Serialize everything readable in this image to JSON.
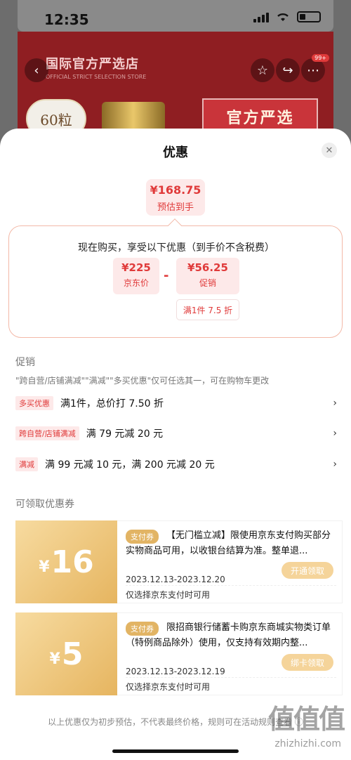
{
  "status_bar": {
    "time": "12:35"
  },
  "product_banner": {
    "store_title": "国际官方严选店",
    "store_subtitle": "OFFICIAL STRICT SELECTION STORE",
    "pill_text": "60粒",
    "stamp_text": "官方严选",
    "cart_badge": "99+"
  },
  "sheet": {
    "title": "优惠",
    "estimated_price": {
      "amount": "¥168.75",
      "label": "预估到手"
    },
    "calculation": {
      "title": "现在购买，享受以下优惠（到手价不含税费）",
      "base": {
        "amount": "¥225",
        "label": "京东价"
      },
      "operator": "-",
      "discount": {
        "amount": "¥56.25",
        "label": "促销"
      },
      "discount_tag": "满1件 7.5 折"
    },
    "promotions": {
      "heading": "促销",
      "note": "\"跨自营/店铺满减\"\"满减\"\"多买优惠\"仅可任选其一，可在购物车更改",
      "items": [
        {
          "tag": "多买优惠",
          "text": "满1件，总价打 7.50 折"
        },
        {
          "tag": "跨自营/店铺满减",
          "text": "满 79 元减 20 元"
        },
        {
          "tag": "满减",
          "text": "满 99 元减 10 元，满 200 元减 20 元"
        }
      ]
    },
    "coupons": {
      "heading": "可领取优惠券",
      "items": [
        {
          "symbol": "¥",
          "value": "16",
          "type": "支付券",
          "description": "【无门槛立减】限使用京东支付购买部分实物商品可用，以收银台结算为准。整单退...",
          "dates": "2023.12.13-2023.12.20",
          "condition": "仅选择京东支付时可用",
          "button": "开通领取"
        },
        {
          "symbol": "¥",
          "value": "5",
          "type": "支付券",
          "description": "限招商银行储蓄卡购京东商城实物类订单（特例商品除外）使用，仅支持有效期内整...",
          "dates": "2023.12.13-2023.12.19",
          "condition": "仅选择京东支付时可用",
          "button": "绑卡领取"
        }
      ]
    },
    "footer": "以上优惠仅为初步预估，不代表最终价格，规则可在活动规则查看 ⓘ"
  },
  "watermark": {
    "logo": "值值值",
    "site": "zhizhizhi.com"
  },
  "colors": {
    "accent": "#e03a3a",
    "gold": "#e2b464",
    "tag_bg": "#fde9e9"
  }
}
